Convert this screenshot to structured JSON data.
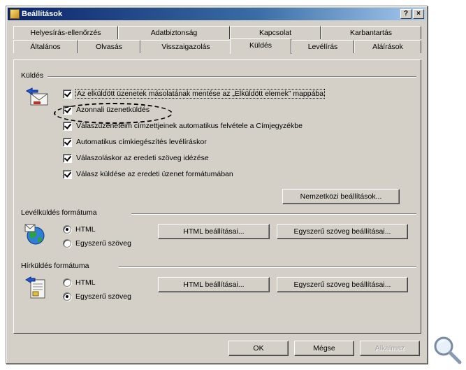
{
  "window": {
    "title": "Beállítások",
    "help_button": "?",
    "close_button": "×"
  },
  "tabs_row_back": [
    {
      "label": "Helyesírás-ellenőrzés"
    },
    {
      "label": "Adatbiztonság"
    },
    {
      "label": "Kapcsolat"
    },
    {
      "label": "Karbantartás"
    }
  ],
  "tabs_row_front": [
    {
      "label": "Általános"
    },
    {
      "label": "Olvasás"
    },
    {
      "label": "Visszaigazolás"
    },
    {
      "label": "Küldés",
      "active": true
    },
    {
      "label": "Levélírás"
    },
    {
      "label": "Aláírások"
    }
  ],
  "sending": {
    "group_label": "Küldés",
    "options": [
      {
        "label": "Az elküldött üzenetek másolatának mentése az „Elküldött elemek” mappába",
        "checked": true,
        "focused": true
      },
      {
        "label": "Azonnali üzenetküldés",
        "checked": true
      },
      {
        "label": "Válaszüzeneteim címzettjeinek automatikus felvétele a Címjegyzékbe",
        "checked": true
      },
      {
        "label": "Automatikus címkiegészítés levélíráskor",
        "checked": true
      },
      {
        "label": "Válaszoláskor az eredeti szöveg idézése",
        "checked": true
      },
      {
        "label": "Válasz küldése az eredeti üzenet formátumában",
        "checked": true
      }
    ],
    "intl_button": "Nemzetközi beállítások..."
  },
  "mail_format": {
    "group_label": "Levélküldés formátuma",
    "radios": [
      {
        "label": "HTML",
        "checked": true
      },
      {
        "label": "Egyszerű szöveg",
        "checked": false
      }
    ],
    "html_settings_button": "HTML beállításai...",
    "plain_settings_button": "Egyszerű szöveg beállításai..."
  },
  "news_format": {
    "group_label": "Hírküldés formátuma",
    "radios": [
      {
        "label": "HTML",
        "checked": false
      },
      {
        "label": "Egyszerű szöveg",
        "checked": true
      }
    ],
    "html_settings_button": "HTML beállításai...",
    "plain_settings_button": "Egyszerű szöveg beállításai..."
  },
  "footer": {
    "ok": "OK",
    "cancel": "Mégse",
    "apply": "Alkalmaz"
  },
  "icons": [
    "app-icon",
    "send-mail-icon",
    "globe-mail-icon",
    "news-icon",
    "magnifier-icon"
  ]
}
